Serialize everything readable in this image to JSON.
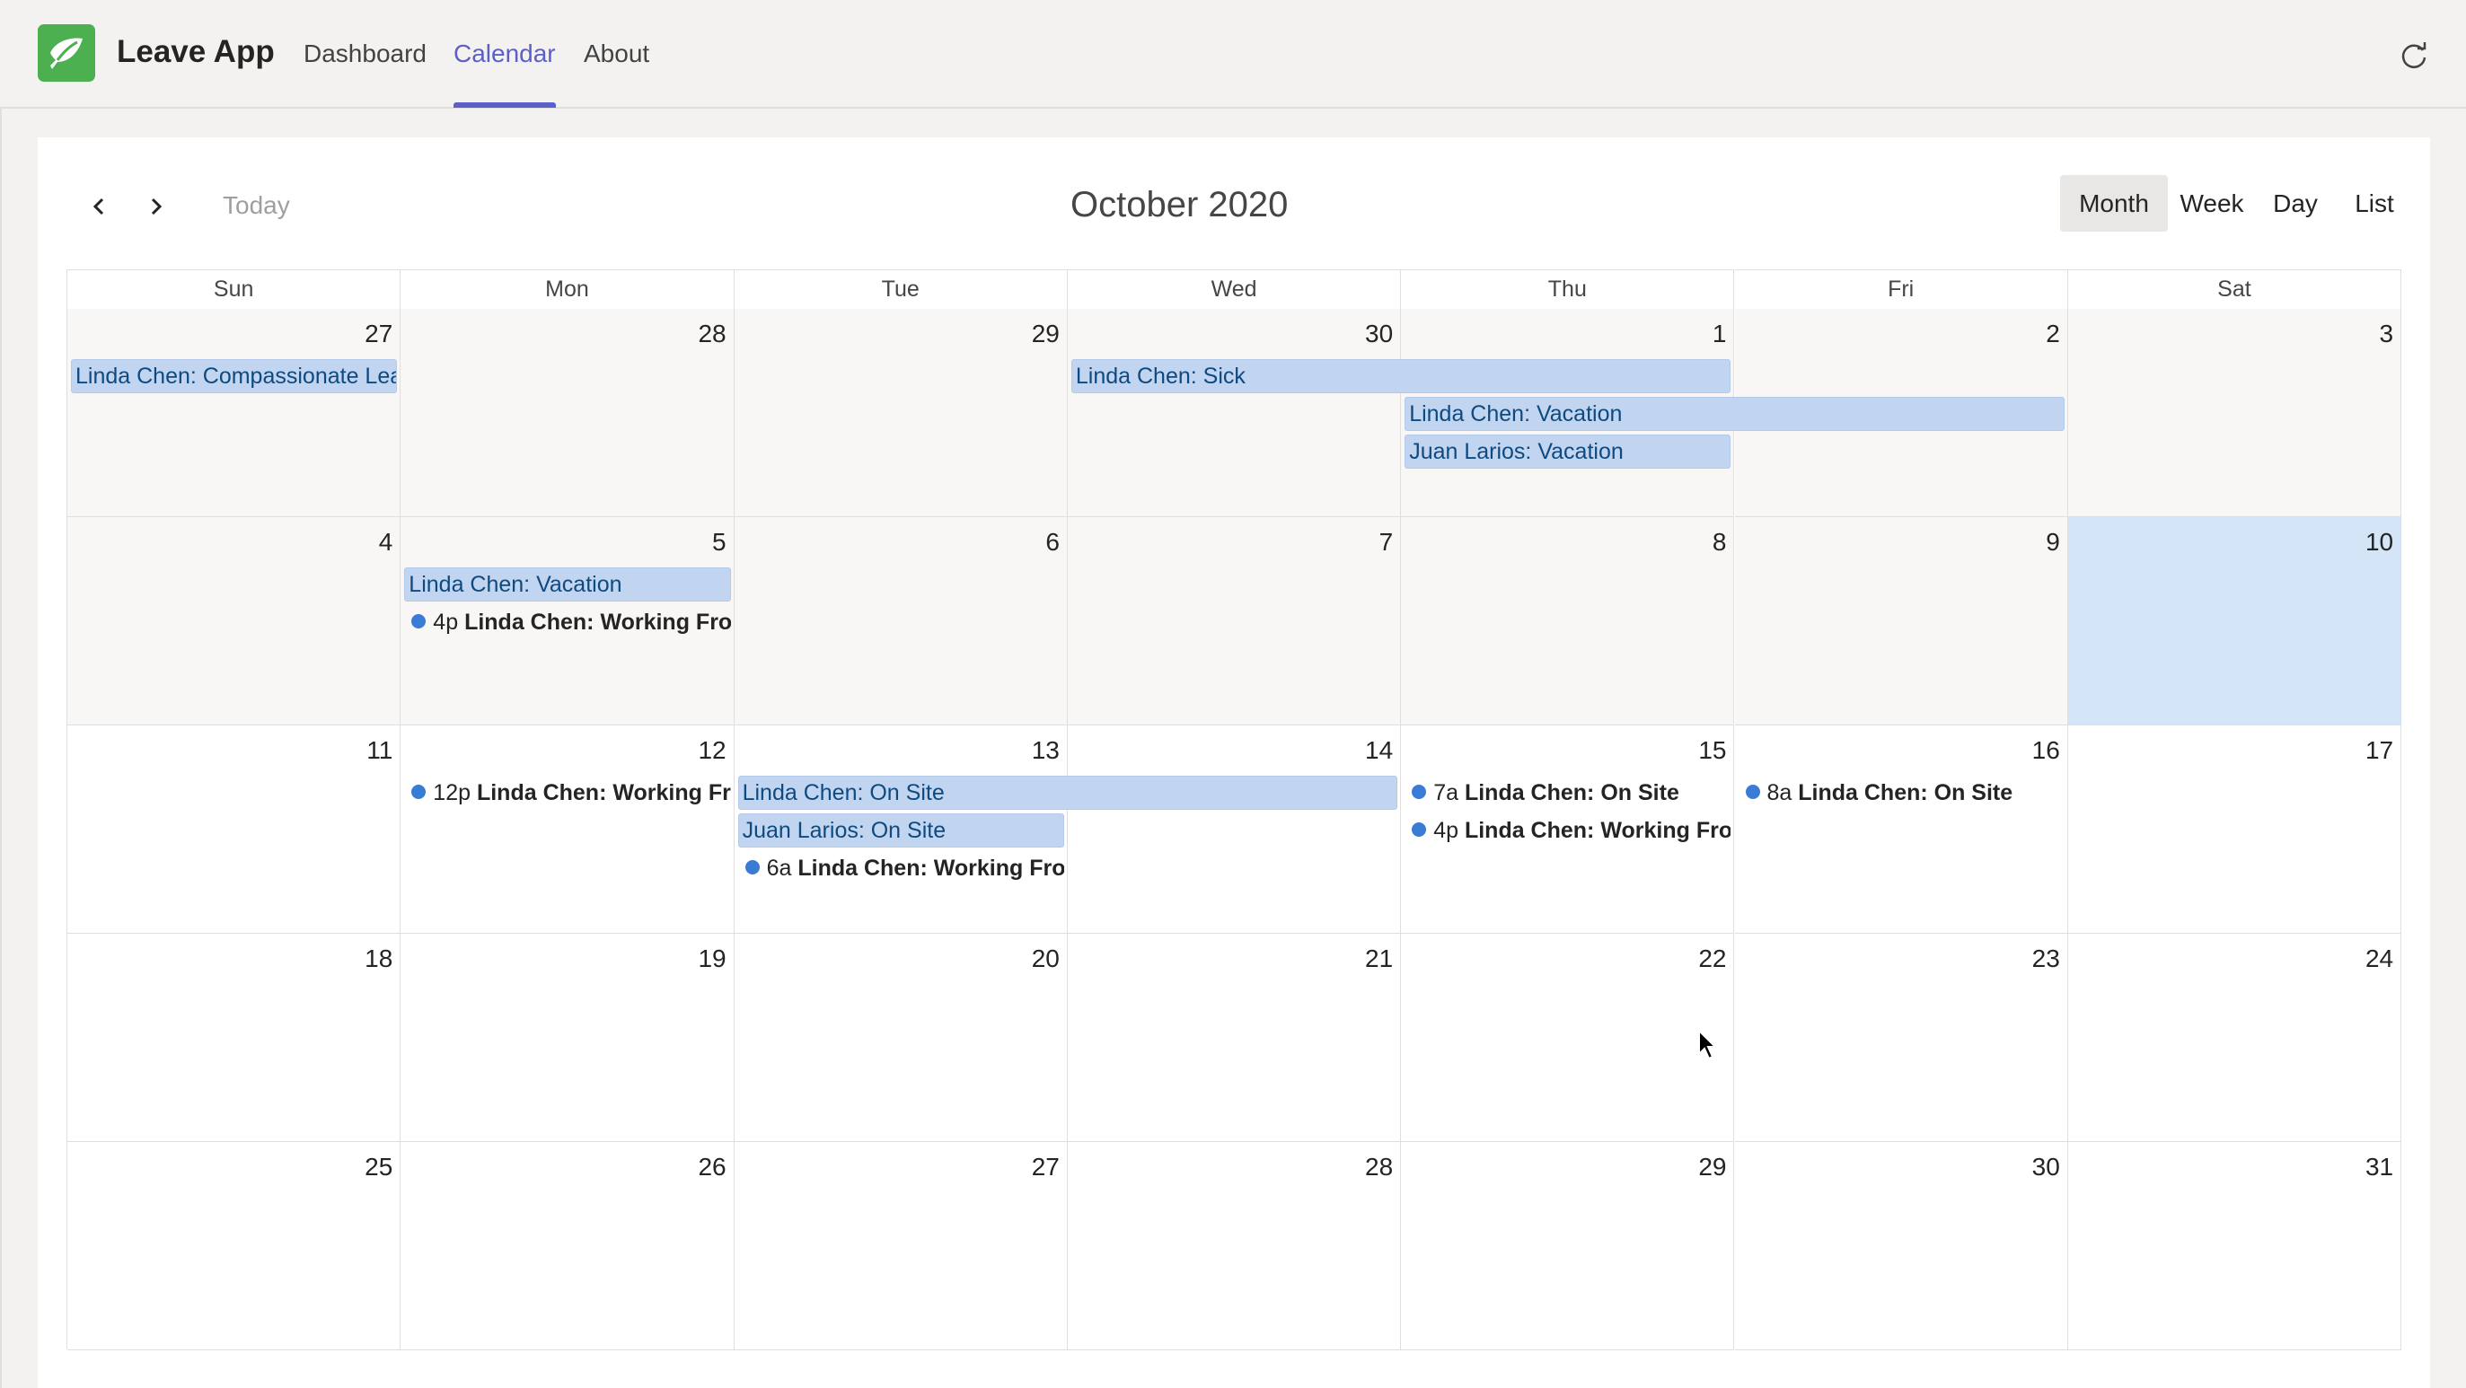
{
  "app": {
    "title": "Leave App",
    "tabs": [
      "Dashboard",
      "Calendar",
      "About"
    ],
    "active_tab": "Calendar",
    "accent_color": "#5b5fc7",
    "logo_color": "#4caf50",
    "refresh_icon": "refresh-icon"
  },
  "toolbar": {
    "prev_icon": "chevron-left-icon",
    "next_icon": "chevron-right-icon",
    "today_label": "Today",
    "title": "October 2020",
    "views": [
      "Month",
      "Week",
      "Day",
      "List"
    ],
    "active_view": "Month"
  },
  "calendar": {
    "weekdays": [
      "Sun",
      "Mon",
      "Tue",
      "Wed",
      "Thu",
      "Fri",
      "Sat"
    ],
    "weeks": [
      [
        "27",
        "28",
        "29",
        "30",
        "1",
        "2",
        "3"
      ],
      [
        "4",
        "5",
        "6",
        "7",
        "8",
        "9",
        "10"
      ],
      [
        "11",
        "12",
        "13",
        "14",
        "15",
        "16",
        "17"
      ],
      [
        "18",
        "19",
        "20",
        "21",
        "22",
        "23",
        "24"
      ],
      [
        "25",
        "26",
        "27",
        "28",
        "29",
        "30",
        "31"
      ]
    ],
    "today_highlight": "10",
    "event_bar_color": "#c1d5f0",
    "today_color": "#d3e5f7",
    "events": [
      {
        "title": "Linda Chen: Compassionate Leave"
      },
      {
        "title": "Linda Chen: Sick"
      },
      {
        "title": "Linda Chen: Vacation"
      },
      {
        "title": "Juan Larios: Vacation"
      },
      {
        "title": "Linda Chen: Vacation"
      },
      {
        "time": "4p",
        "title": "Linda Chen: Working From"
      },
      {
        "time": "12p",
        "title": "Linda Chen: Working From"
      },
      {
        "title": "Linda Chen: On Site"
      },
      {
        "title": "Juan Larios: On Site"
      },
      {
        "time": "6a",
        "title": "Linda Chen: Working From"
      },
      {
        "time": "7a",
        "title": "Linda Chen: On Site"
      },
      {
        "time": "4p",
        "title": "Linda Chen: Working From"
      },
      {
        "time": "8a",
        "title": "Linda Chen: On Site"
      }
    ]
  }
}
